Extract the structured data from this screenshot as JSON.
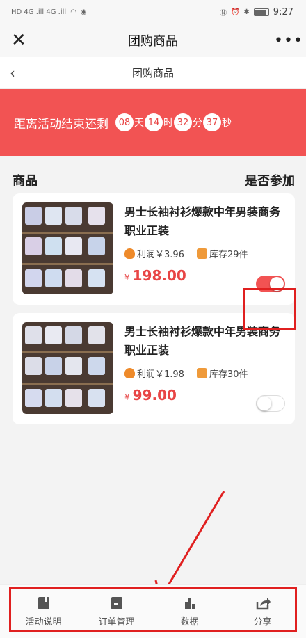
{
  "status_bar": {
    "left": "HD 4G .ill 4G .ill",
    "time": "9:27"
  },
  "wx_header": {
    "title": "团购商品",
    "more": "•••"
  },
  "nav": {
    "title": "团购商品"
  },
  "banner": {
    "text": "距离活动结束还剩",
    "days": "08",
    "days_unit": "天",
    "hours": "14",
    "hours_unit": "时",
    "minutes": "32",
    "minutes_unit": "分",
    "seconds": "37",
    "seconds_unit": "秒",
    "color": "#f25353"
  },
  "columns": {
    "product": "商品",
    "participate": "是否参加"
  },
  "products": [
    {
      "title": "男士长袖衬衫爆款中年男装商务职业正装",
      "profit_label": "利润￥3.96",
      "stock_label": "库存29件",
      "price_symbol": "¥",
      "price": "198.00",
      "participating": true
    },
    {
      "title": "男士长袖衬衫爆款中年男装商务职业正装",
      "profit_label": "利润￥1.98",
      "stock_label": "库存30件",
      "price_symbol": "¥",
      "price": "99.00",
      "participating": false
    }
  ],
  "tabbar": [
    {
      "label": "活动说明",
      "icon": "book-icon"
    },
    {
      "label": "订单管理",
      "icon": "clipboard-icon"
    },
    {
      "label": "数据",
      "icon": "bar-chart-icon"
    },
    {
      "label": "分享",
      "icon": "share-icon"
    }
  ],
  "colors": {
    "accent": "#f25353",
    "price": "#e84545",
    "annotation": "#e02020"
  }
}
